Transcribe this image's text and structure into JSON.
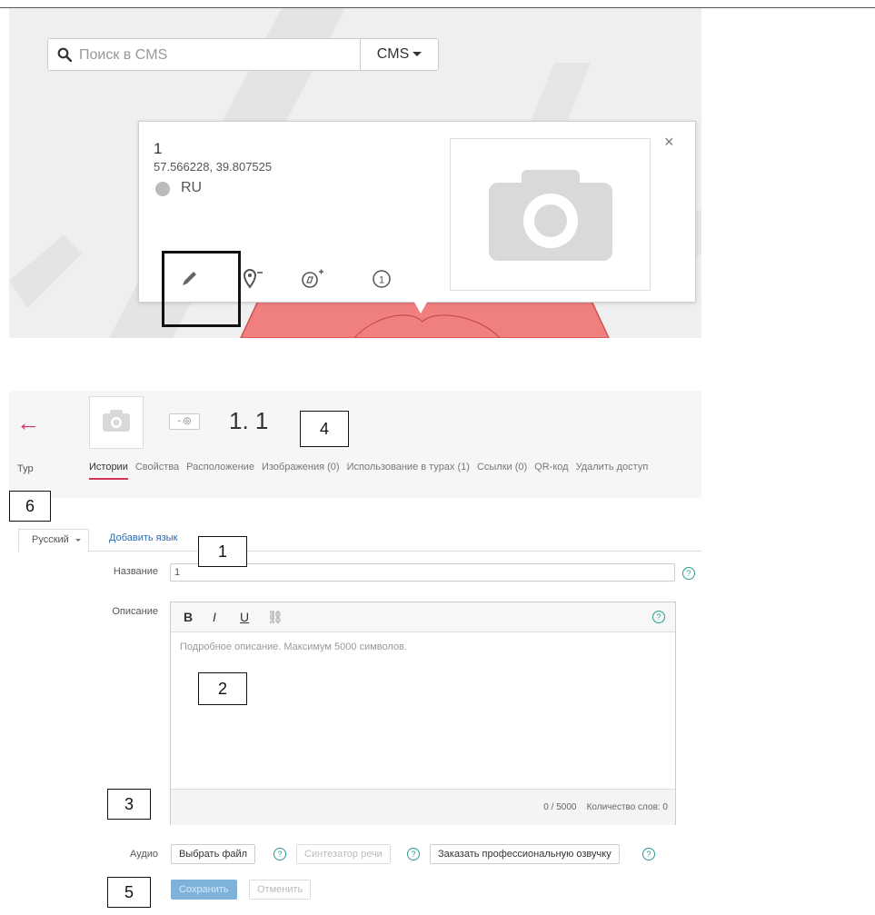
{
  "map": {
    "search": {
      "placeholder": "Поиск в CMS"
    },
    "cms_button": {
      "label": "CMS"
    },
    "popup": {
      "title": "1",
      "coords": "57.566228, 39.807525",
      "lang": "RU",
      "close": "×",
      "tools": [
        "pencil-icon",
        "location-remove-icon",
        "compass-add-icon",
        "info-number-icon"
      ],
      "num": "1"
    }
  },
  "editor": {
    "back": "←",
    "tour_label": "Тур",
    "lang_mini": "- ◎",
    "title": "1. 1",
    "tabs": [
      "Истории",
      "Свойства",
      "Расположение",
      "Изображения (0)",
      "Использование в турах (1)",
      "Ссылки (0)",
      "QR-код",
      "Удалить доступ"
    ],
    "lang_tab": "Русский",
    "add_lang": "Добавить язык",
    "name_label": "Название",
    "name_value": "1",
    "desc_label": "Описание",
    "toolbar": {
      "bold": "B",
      "italic": "I",
      "underline": "U",
      "link": "⛓"
    },
    "desc_placeholder": "Подробное описание. Максимум 5000 символов.",
    "char_count": "0 / 5000",
    "word_count": "Количество слов: 0",
    "audio_label": "Аудио",
    "choose_file": "Выбрать файл",
    "speech_synth": "Синтезатор речи",
    "order_voice": "Заказать профессиональную озвучку",
    "save": "Сохранить",
    "cancel": "Отменить",
    "help": "?"
  },
  "callouts": [
    "1",
    "2",
    "3",
    "4",
    "5",
    "6"
  ],
  "colors": {
    "accent": "#d0355a",
    "link": "#2a6ab0",
    "help": "#2a9d8f"
  }
}
